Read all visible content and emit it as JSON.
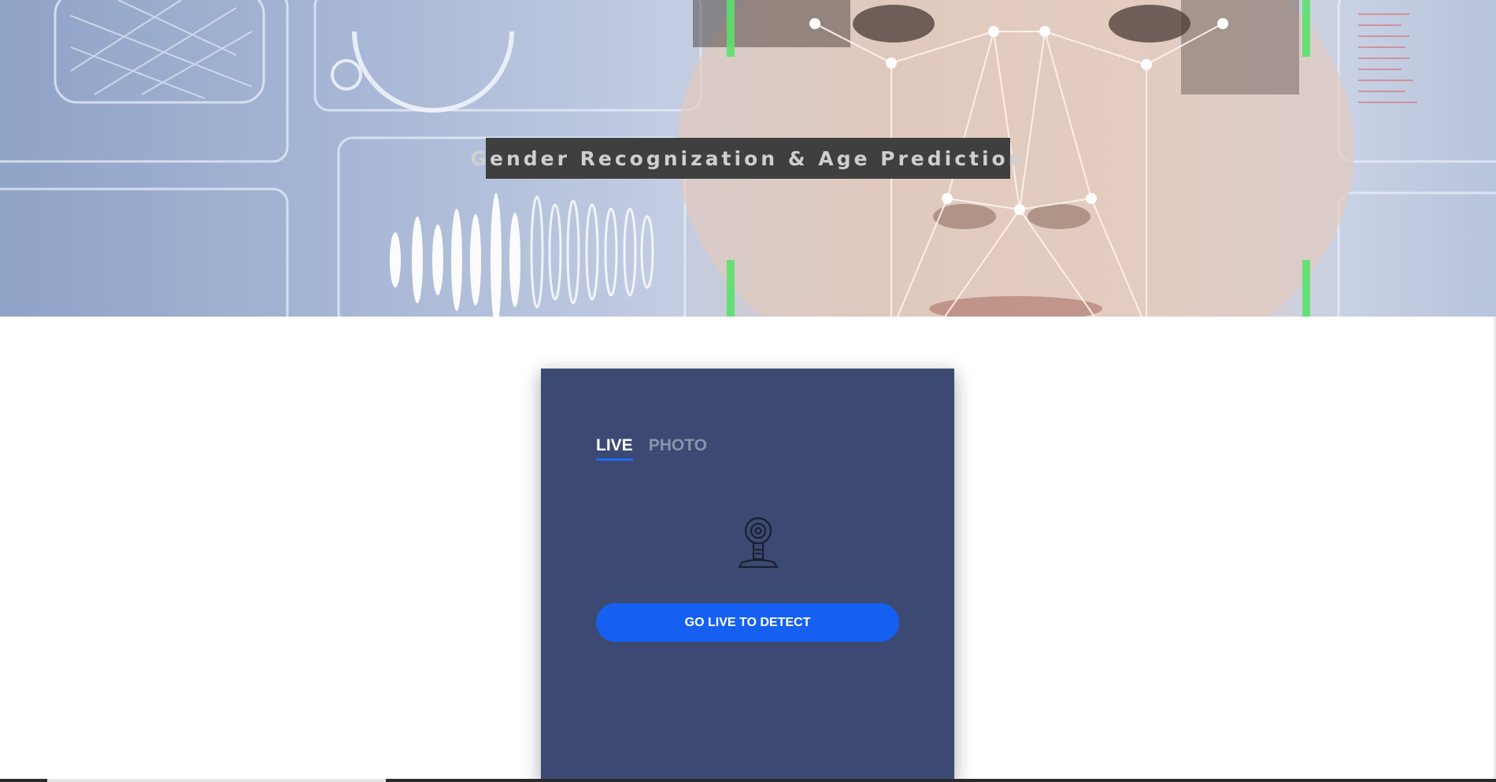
{
  "hero": {
    "title": "Gender Recognization & Age Prediction"
  },
  "detector": {
    "tabs": [
      {
        "label": "LIVE",
        "active": true
      },
      {
        "label": "PHOTO",
        "active": false
      }
    ],
    "camera_icon": "webcam-icon",
    "go_live_label": "GO LIVE TO DETECT"
  },
  "colors": {
    "card_background": "#3c4a73",
    "button_primary": "#1560f0",
    "tab_active_underline": "#1d6af5",
    "title_box": "#3f3f3f"
  }
}
